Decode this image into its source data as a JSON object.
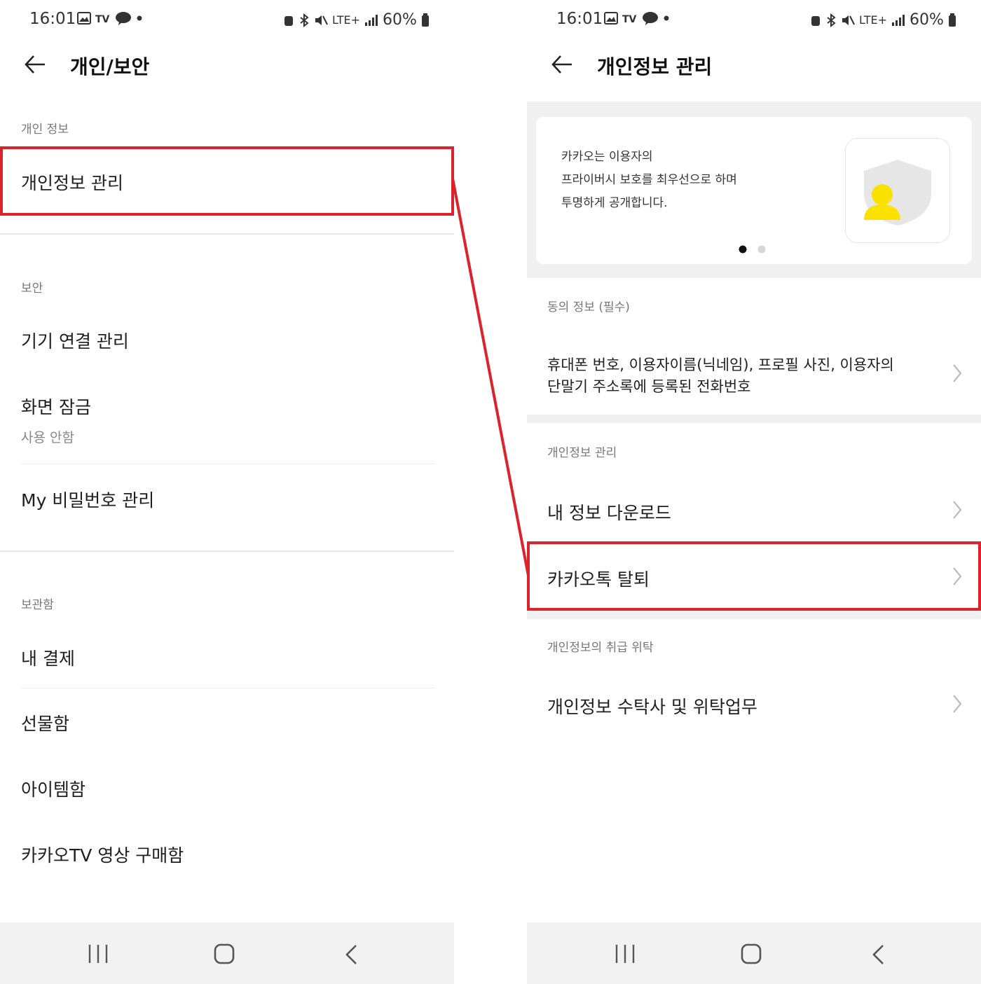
{
  "left": {
    "status": {
      "time": "16:01",
      "battery": "60%",
      "network": "LTE+"
    },
    "header": {
      "title": "개인/보안"
    },
    "sections": {
      "personal": {
        "label": "개인 정보",
        "items": [
          "개인정보 관리"
        ]
      },
      "security": {
        "label": "보안",
        "device": "기기 연결 관리",
        "lock": "화면 잠금",
        "lock_sub": "사용 안함",
        "password": "My 비밀번호 관리"
      },
      "storage": {
        "label": "보관함",
        "items": [
          "내 결제",
          "선물함",
          "아이템함",
          "카카오TV 영상 구매함"
        ]
      }
    }
  },
  "right": {
    "status": {
      "time": "16:01",
      "battery": "60%",
      "network": "LTE+"
    },
    "header": {
      "title": "개인정보 관리"
    },
    "banner": {
      "line1": "카카오는 이용자의",
      "line2": "프라이버시 보호를 최우선으로 하며",
      "line3": "투명하게 공개합니다."
    },
    "consent": {
      "label": "동의 정보 (필수)",
      "line1": "휴대폰 번호, 이용자이름(닉네임), 프로필 사진, 이용자의",
      "line2": "단말기 주소록에 등록된 전화번호"
    },
    "manage": {
      "label": "개인정보 관리",
      "download": "내 정보 다운로드",
      "withdraw": "카카오톡 탈퇴"
    },
    "outsourcing": {
      "label": "개인정보의 취급 위탁",
      "item": "개인정보 수탁사 및 위탁업무"
    }
  },
  "colors": {
    "highlight": "#d9232d",
    "kakao_yellow": "#fae100",
    "nav_bg": "#f2f2f2"
  },
  "icons": [
    "back-arrow-icon",
    "chevron-right-icon",
    "recent-apps-icon",
    "home-icon",
    "nav-back-icon",
    "shield-person-icon"
  ]
}
